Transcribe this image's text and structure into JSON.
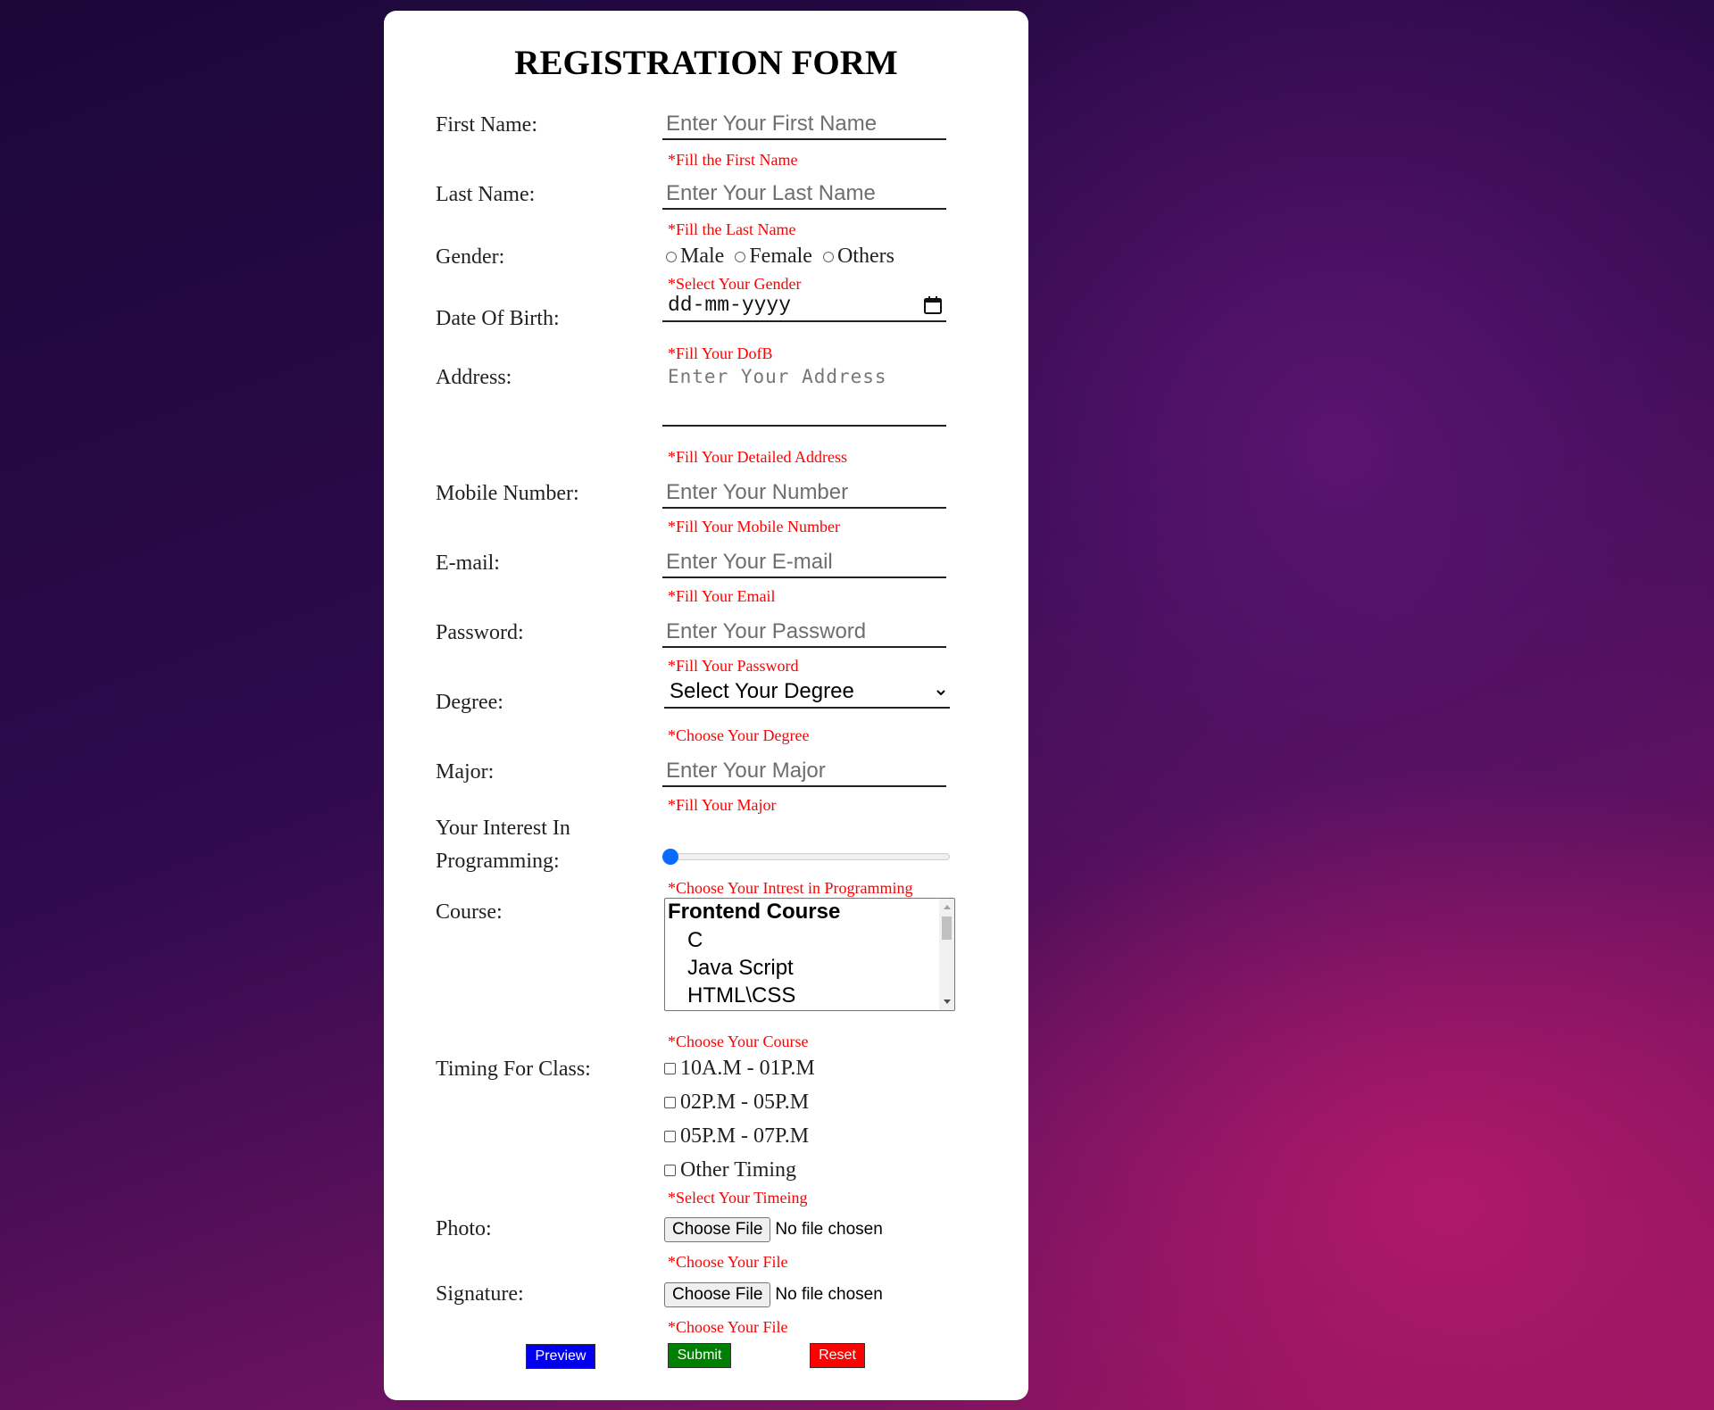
{
  "form": {
    "title": "REGISTRATION FORM",
    "first_name": {
      "label": "First Name:",
      "placeholder": "Enter Your First Name",
      "error": "*Fill the First Name"
    },
    "last_name": {
      "label": "Last Name:",
      "placeholder": "Enter Your Last Name",
      "error": "*Fill the Last Name"
    },
    "gender": {
      "label": "Gender:",
      "options": [
        "Male",
        "Female",
        "Others"
      ],
      "error": "*Select Your Gender"
    },
    "dob": {
      "label": "Date Of Birth:",
      "placeholder": "dd-mm-yyyy",
      "error": "*Fill Your DofB"
    },
    "address": {
      "label": "Address:",
      "placeholder": "Enter Your Address",
      "error": "*Fill Your Detailed Address"
    },
    "mobile": {
      "label": "Mobile Number:",
      "placeholder": "Enter Your Number",
      "error": "*Fill Your Mobile Number"
    },
    "email": {
      "label": "E-mail:",
      "placeholder": "Enter Your E-mail",
      "error": "*Fill Your Email"
    },
    "password": {
      "label": "Password:",
      "placeholder": "Enter Your Password",
      "error": "*Fill Your Password"
    },
    "degree": {
      "label": "Degree:",
      "selected": "Select Your Degree",
      "error": "*Choose Your Degree"
    },
    "major": {
      "label": "Major:",
      "placeholder": "Enter Your Major",
      "error": "*Fill Your Major"
    },
    "interest": {
      "label_line1": "Your Interest In",
      "label_line2": "Programming:",
      "value": 0,
      "error": "*Choose Your Intrest in Programming"
    },
    "course": {
      "label": "Course:",
      "group": "Frontend Course",
      "options": [
        "C",
        "Java Script",
        "HTML\\CSS"
      ],
      "error": "*Choose Your Course"
    },
    "timing": {
      "label": "Timing For Class:",
      "options": [
        "10A.M - 01P.M",
        "02P.M - 05P.M",
        "05P.M - 07P.M",
        "Other Timing"
      ],
      "error": "*Select Your Timeing"
    },
    "photo": {
      "label": "Photo:",
      "button": "Choose File",
      "status": "No file chosen",
      "error": "*Choose Your File"
    },
    "signature": {
      "label": "Signature:",
      "button": "Choose File",
      "status": "No file chosen",
      "error": "*Choose Your File"
    },
    "buttons": {
      "preview": "Preview",
      "submit": "Submit",
      "reset": "Reset"
    },
    "colors": {
      "error": "#ff0000",
      "preview": "#0000ee",
      "submit": "#008000",
      "reset": "#ff0000",
      "slider": "#0a6cff"
    }
  }
}
